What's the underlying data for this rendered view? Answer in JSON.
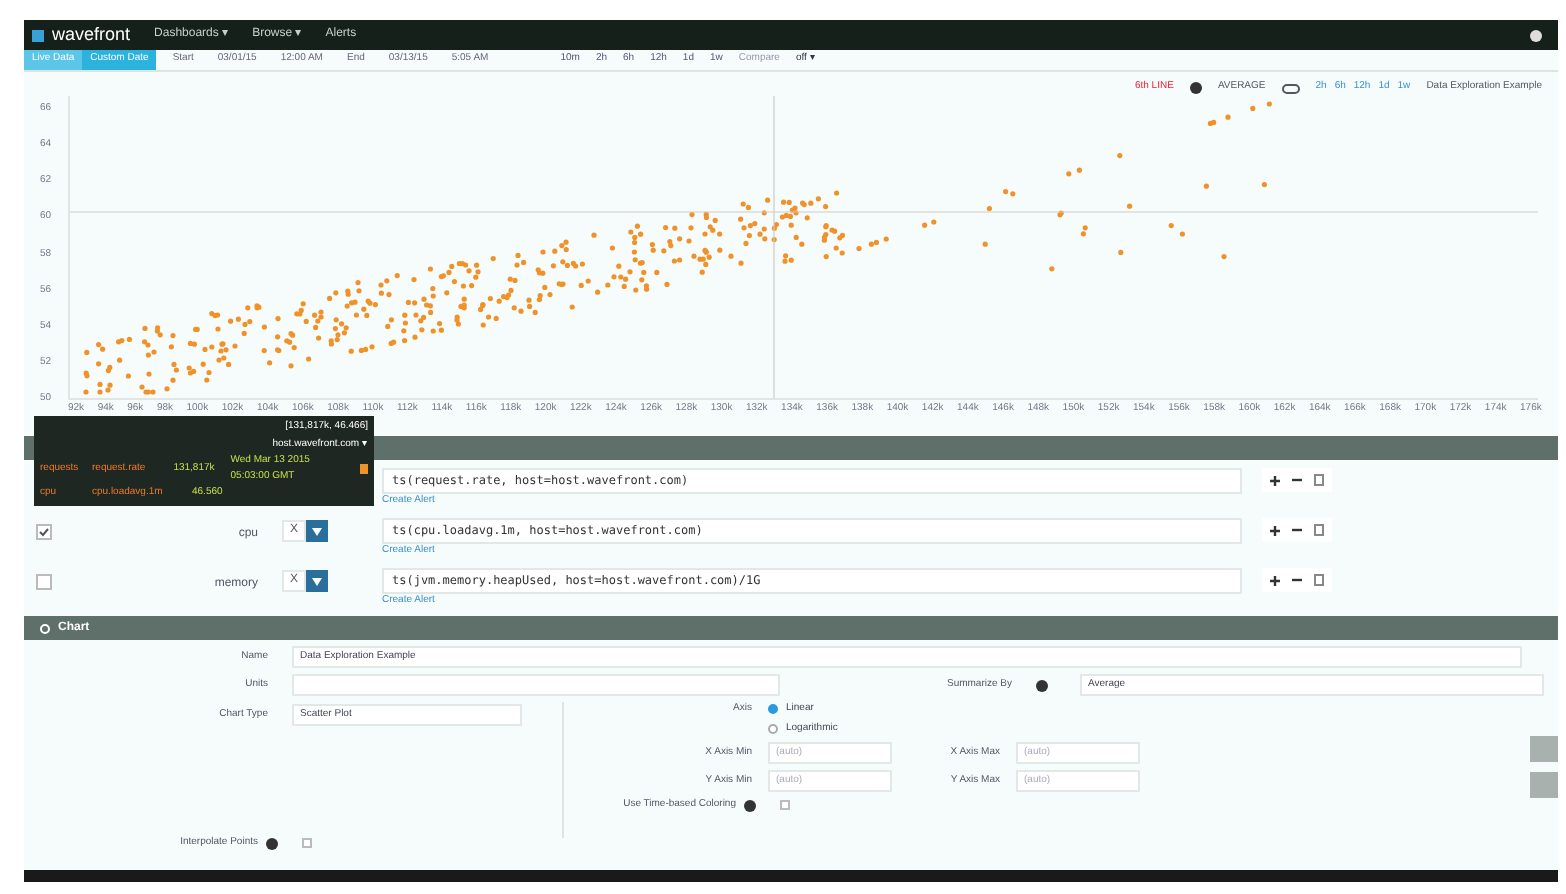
{
  "nav": {
    "logo": "wavefront",
    "items": [
      {
        "label": "Dashboards ▾"
      },
      {
        "label": "Browse ▾"
      },
      {
        "label": "Alerts"
      }
    ]
  },
  "toolbar": {
    "buttons": [
      {
        "label": "Live Data",
        "selected": false
      },
      {
        "label": "Custom Date",
        "selected": true
      }
    ],
    "start_label": "Start",
    "start_date": "03/01/15",
    "start_time": "12:00 AM",
    "end_label": "End",
    "end_date": "03/13/15",
    "end_time": "5:05 AM",
    "ranges": [
      "10m",
      "2h",
      "6h",
      "12h",
      "1d",
      "1w"
    ],
    "compare_label": "Compare",
    "compare_value": "off ▾"
  },
  "chart": {
    "legend": "6th LINE",
    "summary": "AVERAGE",
    "ranges": [
      "2h",
      "6h",
      "12h",
      "1d",
      "1w"
    ],
    "title": "Data Exploration Example",
    "y_ticks": [
      "66",
      "64",
      "62",
      "60",
      "58",
      "56",
      "54",
      "52",
      "50"
    ],
    "x_ticks": [
      "92k",
      "94k",
      "96k",
      "98k",
      "100k",
      "102k",
      "104k",
      "106k",
      "108k",
      "110k",
      "112k",
      "114k",
      "116k",
      "118k",
      "120k",
      "122k",
      "124k",
      "126k",
      "128k",
      "130k",
      "132k",
      "134k",
      "136k",
      "138k",
      "140k",
      "142k",
      "144k",
      "146k",
      "148k",
      "150k",
      "152k",
      "154k",
      "156k",
      "158k",
      "160k",
      "162k",
      "164k",
      "166k",
      "168k",
      "170k",
      "172k",
      "174k",
      "176k"
    ]
  },
  "tooltip": {
    "coords": "[131,817k, 46.466]",
    "host": "host.wavefront.com ▾",
    "rows": [
      {
        "name": "requests",
        "metric": "request.rate",
        "value": "131,817k",
        "time": "Wed Mar 13 2015 05:03:00 GMT"
      },
      {
        "name": "cpu",
        "metric": "cpu.loadavg.1m",
        "value": "46.560"
      }
    ]
  },
  "queries": [
    {
      "query": "ts(request.rate, host=host.wavefront.com)",
      "link": "Create Alert"
    },
    {
      "checked": true,
      "name": "cpu",
      "x_label": "X",
      "query": "ts(cpu.loadavg.1m, host=host.wavefront.com)",
      "link": "Create Alert"
    },
    {
      "checked": false,
      "name": "memory",
      "x_label": "X",
      "query": "ts(jvm.memory.heapUsed, host=host.wavefront.com)/1G",
      "link": "Create Alert"
    }
  ],
  "chart_section": {
    "title": "Chart",
    "name_label": "Name",
    "name_value": "Data Exploration Example",
    "units_label": "Units",
    "summarize_label": "Summarize By",
    "summarize_value": "Average",
    "type_label": "Chart Type",
    "type_value": "Scatter Plot",
    "axis_label": "Axis",
    "axis_options": [
      {
        "label": "Linear",
        "selected": true
      },
      {
        "label": "Logarithmic",
        "selected": false
      }
    ],
    "limits": [
      {
        "label": "X Axis Min",
        "placeholder": "(auto)"
      },
      {
        "label": "X Axis Max",
        "placeholder": "(auto)"
      },
      {
        "label": "Y Axis Min",
        "placeholder": "(auto)"
      },
      {
        "label": "Y Axis Max",
        "placeholder": "(auto)"
      }
    ],
    "time_coloring_label": "Use Time-based Coloring",
    "time_coloring": false,
    "interpolate_label": "Interpolate Points",
    "interpolate": false
  }
}
